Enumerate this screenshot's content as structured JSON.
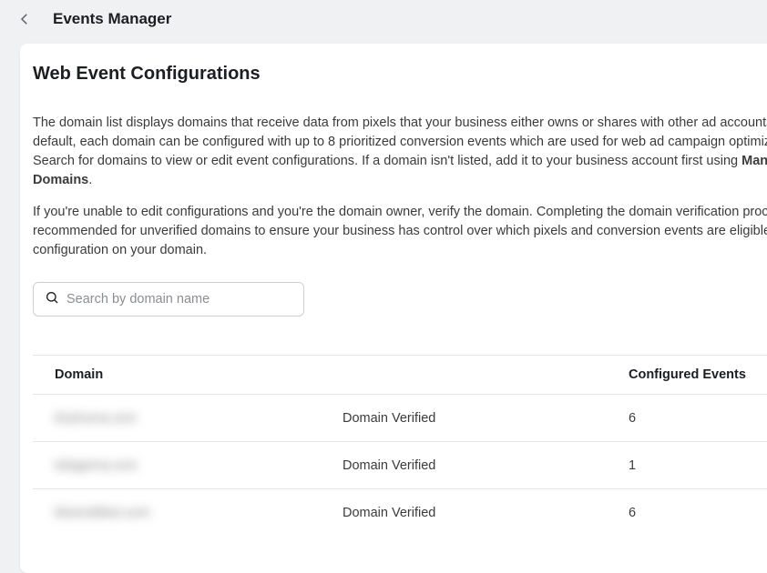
{
  "topbar": {
    "title": "Events Manager"
  },
  "page": {
    "title": "Web Event Configurations"
  },
  "paragraphs": {
    "p1_a": "The domain list displays domains that receive data from pixels that your business either owns or shares with other ad accounts. By default, each domain can be configured with up to 8 prioritized conversion events which are used for web ad campaign optimization. Search for domains to view or edit event configurations. If a domain isn't listed, add it to your business account first using ",
    "p1_bold": "Manage Domains",
    "p1_b": ".",
    "p2": "If you're unable to edit configurations and you're the domain owner, verify the domain. Completing the domain verification process is recommended for unverified domains to ensure your business has control over which pixels and conversion events are eligible for configuration on your domain."
  },
  "search": {
    "placeholder": "Search by domain name"
  },
  "table": {
    "headers": {
      "domain": "Domain",
      "configured_events": "Configured Events"
    },
    "rows": [
      {
        "domain_masked": "tinyhuma.com",
        "status": "Domain Verified",
        "events": "6"
      },
      {
        "domain_masked": "tolagema.com",
        "status": "Domain Verified",
        "events": "1"
      },
      {
        "domain_masked": "blowndbker.com",
        "status": "Domain Verified",
        "events": "6"
      }
    ]
  }
}
